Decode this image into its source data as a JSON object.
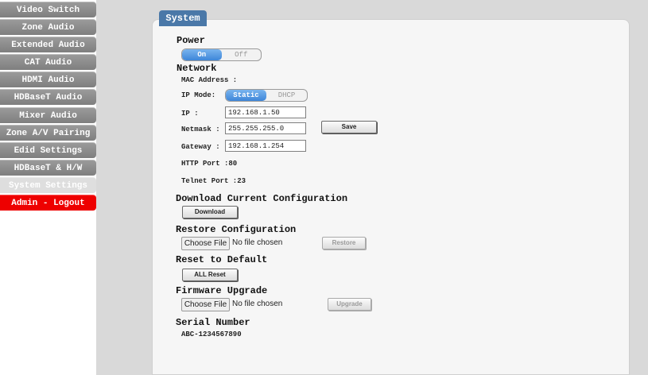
{
  "sidebar": {
    "items": [
      {
        "label": "Video Switch"
      },
      {
        "label": "Zone Audio"
      },
      {
        "label": "Extended Audio"
      },
      {
        "label": "CAT Audio"
      },
      {
        "label": "HDMI Audio"
      },
      {
        "label": "HDBaseT Audio"
      },
      {
        "label": "Mixer Audio"
      },
      {
        "label": "Zone A/V Pairing"
      },
      {
        "label": "Edid Settings"
      },
      {
        "label": "HDBaseT & H/W"
      },
      {
        "label": "System Settings"
      },
      {
        "label": "Admin - Logout"
      }
    ],
    "active": "System Settings"
  },
  "section": {
    "title": "System"
  },
  "power": {
    "heading": "Power",
    "on_label": "On",
    "off_label": "Off",
    "state": "On"
  },
  "network": {
    "heading": "Network",
    "mac_label": "MAC Address :",
    "ip_mode_label": "IP Mode:",
    "ip_mode_static": "Static",
    "ip_mode_dhcp": "DHCP",
    "ip_mode_selected": "Static",
    "ip_label": "IP :",
    "ip_value": "192.168.1.50",
    "netmask_label": "Netmask :",
    "netmask_value": "255.255.255.0",
    "gateway_label": "Gateway :",
    "gateway_value": "192.168.1.254",
    "save_label": "Save",
    "http_port_label": "HTTP Port :80",
    "telnet_port_label": "Telnet Port :23"
  },
  "download": {
    "heading": "Download Current Configuration",
    "button_label": "Download"
  },
  "restore": {
    "heading": "Restore Configuration",
    "choose_label": "Choose File",
    "file_status": "No file chosen",
    "button_label": "Restore"
  },
  "reset": {
    "heading": "Reset to Default",
    "button_label": "ALL Reset"
  },
  "firmware": {
    "heading": "Firmware Upgrade",
    "choose_label": "Choose File",
    "file_status": "No file chosen",
    "button_label": "Upgrade"
  },
  "serial": {
    "heading": "Serial Number",
    "value": "ABC-1234567890"
  },
  "colors": {
    "accent": "#4a78a8",
    "nav": "#8c8c8c",
    "logout": "#ee0000",
    "toggle_on": "#3e86d9"
  }
}
